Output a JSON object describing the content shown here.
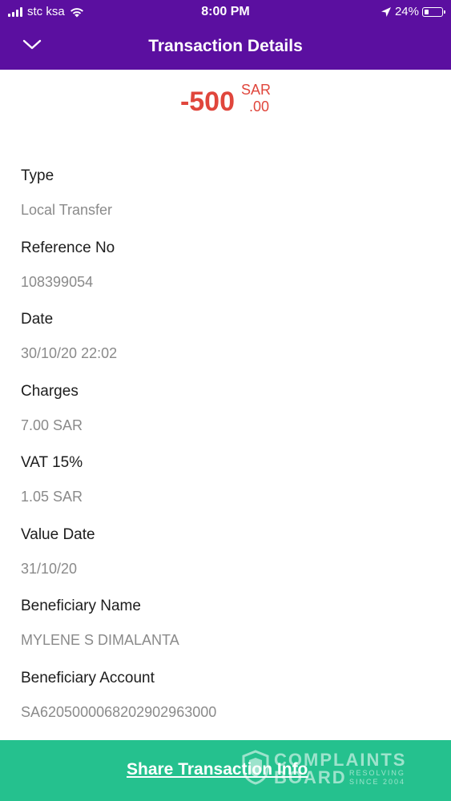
{
  "status_bar": {
    "carrier": "stc ksa",
    "time": "8:00 PM",
    "battery": "24%",
    "battery_level": 0.24
  },
  "header": {
    "title": "Transaction Details",
    "back_icon": "chevron-down-icon"
  },
  "amount": {
    "value": "-500",
    "currency": "SAR",
    "decimal": ".00",
    "color": "#e0463c"
  },
  "details": [
    {
      "label": "Type",
      "value": "Local Transfer"
    },
    {
      "label": "Reference No",
      "value": "108399054"
    },
    {
      "label": "Date",
      "value": "30/10/20 22:02"
    },
    {
      "label": "Charges",
      "value": "7.00 SAR"
    },
    {
      "label": "VAT 15%",
      "value": "1.05 SAR"
    },
    {
      "label": "Value Date",
      "value": "31/10/20"
    },
    {
      "label": "Beneficiary Name",
      "value": "MYLENE S DIMALANTA"
    },
    {
      "label": "Beneficiary Account",
      "value": "SA6205000068202902963000"
    }
  ],
  "share": {
    "label": "Share Transaction Info",
    "color": "#25c18e"
  },
  "watermark": {
    "line1": "COMPLAINTS",
    "line2": "BOARD",
    "tagline": "RESOLVING SINCE 2004"
  },
  "colors": {
    "header_bg": "#5b0fa0",
    "label_text": "#1c1c1c",
    "value_text": "#8a8a8a"
  }
}
